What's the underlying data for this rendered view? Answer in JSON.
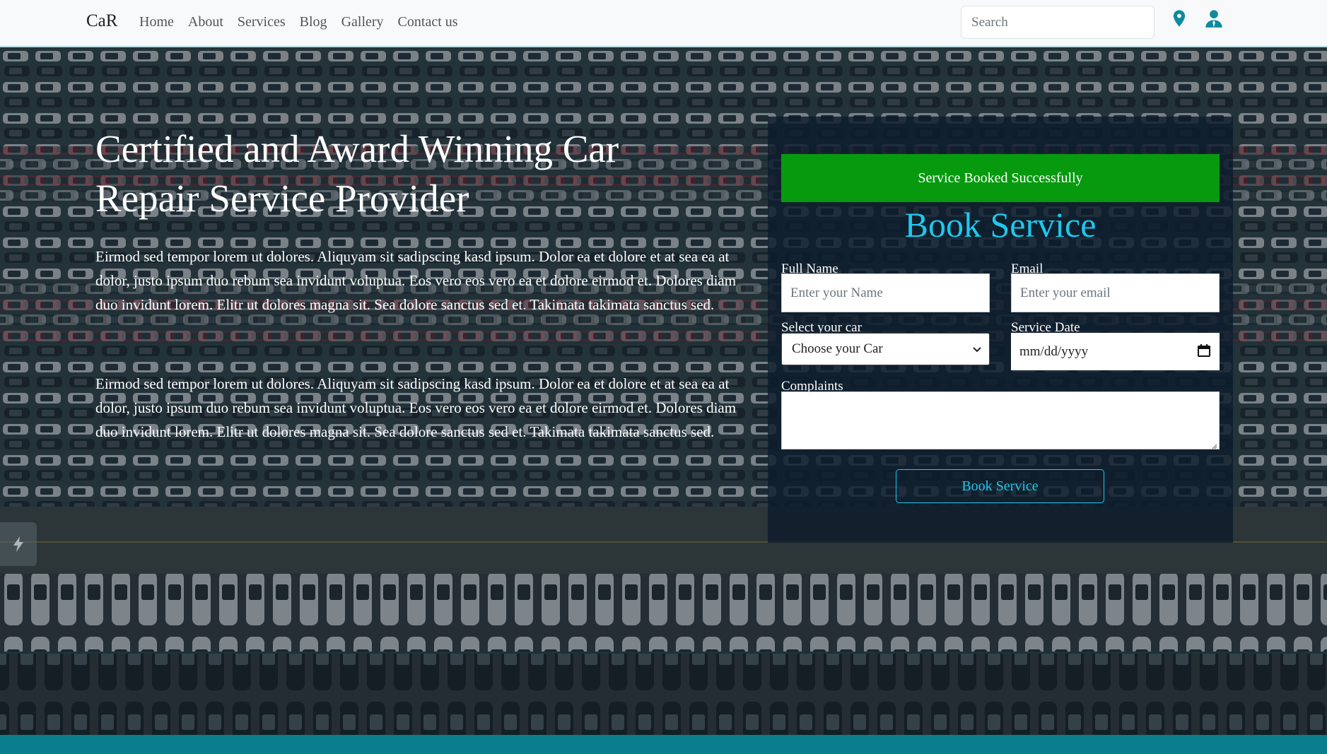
{
  "navbar": {
    "brand": "CaR",
    "links": [
      "Home",
      "About",
      "Services",
      "Blog",
      "Gallery",
      "Contact us"
    ],
    "search_placeholder": "Search",
    "icons": [
      "location-pin-icon",
      "user-icon"
    ]
  },
  "hero": {
    "title": "Certified and Award Winning Car Repair Service Provider",
    "paragraphs": [
      "Eirmod sed tempor lorem ut dolores. Aliquyam sit sadipscing kasd ipsum. Dolor ea et dolore et at sea ea at dolor, justo ipsum duo rebum sea invidunt voluptua. Eos vero eos vero ea et dolore eirmod et. Dolores diam duo invidunt lorem. Elitr ut dolores magna sit. Sea dolore sanctus sed et. Takimata takimata sanctus sed.",
      "Eirmod sed tempor lorem ut dolores. Aliquyam sit sadipscing kasd ipsum. Dolor ea et dolore et at sea ea at dolor, justo ipsum duo rebum sea invidunt voluptua. Eos vero eos vero ea et dolore eirmod et. Dolores diam duo invidunt lorem. Elitr ut dolores magna sit. Sea dolore sanctus sed et. Takimata takimata sanctus sed."
    ]
  },
  "form": {
    "alert": "Service Booked Successfully",
    "title": "Book Service",
    "full_name_label": "Full Name",
    "full_name_placeholder": "Enter your Name",
    "email_label": "Email",
    "email_placeholder": "Enter your email",
    "car_label": "Select your car",
    "car_selected": "Choose your Car",
    "date_label": "Service Date",
    "date_value": "mm/dd/yyyy",
    "complaints_label": "Complaints",
    "submit_label": "Book Service"
  },
  "colors": {
    "accent": "#1ec8ee",
    "success": "#079a0f",
    "footer": "#0b7e8d"
  }
}
